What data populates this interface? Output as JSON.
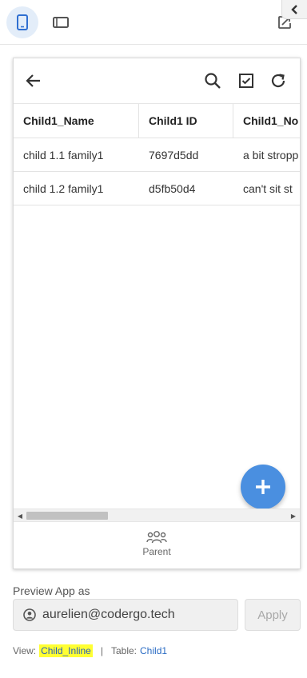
{
  "toolbar": {
    "phone_icon": "phone-icon",
    "tablet_icon": "tablet-icon",
    "external_icon": "open-external-icon",
    "collapse_icon": "chevron-left-icon"
  },
  "app": {
    "header_icons": [
      "back-arrow-icon",
      "search-icon",
      "check-box-icon",
      "refresh-icon"
    ],
    "table": {
      "columns": [
        "Child1_Name",
        "Child1 ID",
        "Child1_No"
      ],
      "rows": [
        [
          "child 1.1 family1",
          "7697d5dd",
          "a bit stropp"
        ],
        [
          "child 1.2 family1",
          "d5fb50d4",
          "can't sit st"
        ]
      ]
    },
    "fab_icon": "plus-icon",
    "bottom_nav": {
      "label": "Parent",
      "icon": "people-icon"
    }
  },
  "preview": {
    "label": "Preview App as",
    "user_email": "aurelien@codergo.tech",
    "apply_label": "Apply"
  },
  "footer": {
    "view_prefix": "View:",
    "view_name": "Child_Inline",
    "separator": "|",
    "table_prefix": "Table:",
    "table_name": "Child1"
  },
  "colors": {
    "accent": "#4a8fe0",
    "highlight": "#ffff33",
    "link": "#2b6cc4"
  }
}
